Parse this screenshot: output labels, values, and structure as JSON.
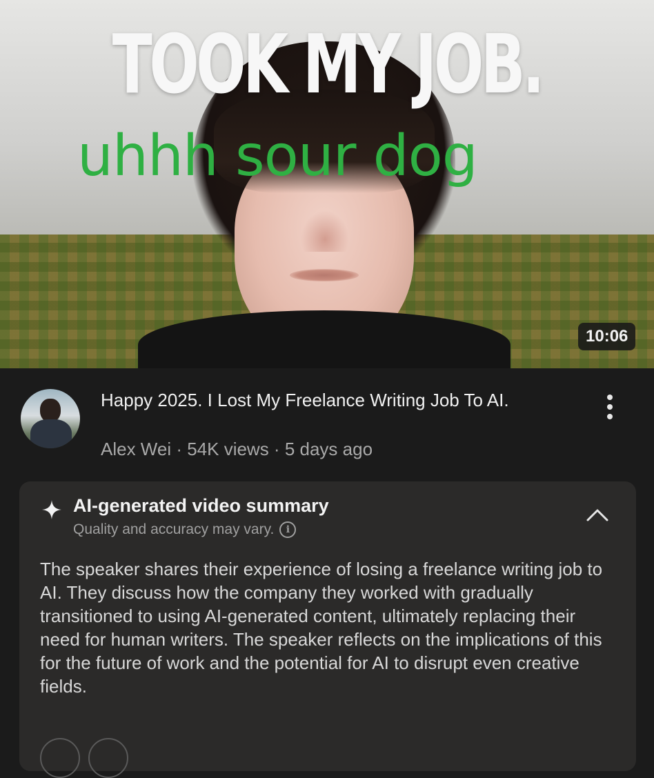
{
  "thumbnail": {
    "title_text": "TOOK MY JOB.",
    "overlay_text": "uhhh sour dog",
    "duration": "10:06"
  },
  "video": {
    "title": "Happy 2025. I Lost My Freelance Writing Job To AI.",
    "meta": "Alex Wei · 54K views · 5 days ago",
    "channel_avatar": "avatar-photo"
  },
  "summary": {
    "title": "AI-generated video summary",
    "subtitle": "Quality and accuracy may vary.",
    "body": "The speaker shares their experience of losing a freelance writing job to AI. They discuss how the company they worked with gradually transitioned to using AI-generated content, ultimately replacing their need for human writers. The speaker reflects on the implications of this for the future of work and the potential for AI to disrupt even creative fields.",
    "icons": {
      "sparkle": "sparkle-icon",
      "info": "info-icon",
      "collapse": "chevron-up-icon"
    }
  },
  "colors": {
    "background": "#1b1b1b",
    "card": "#2b2a29",
    "overlay_green": "#2fb043"
  }
}
